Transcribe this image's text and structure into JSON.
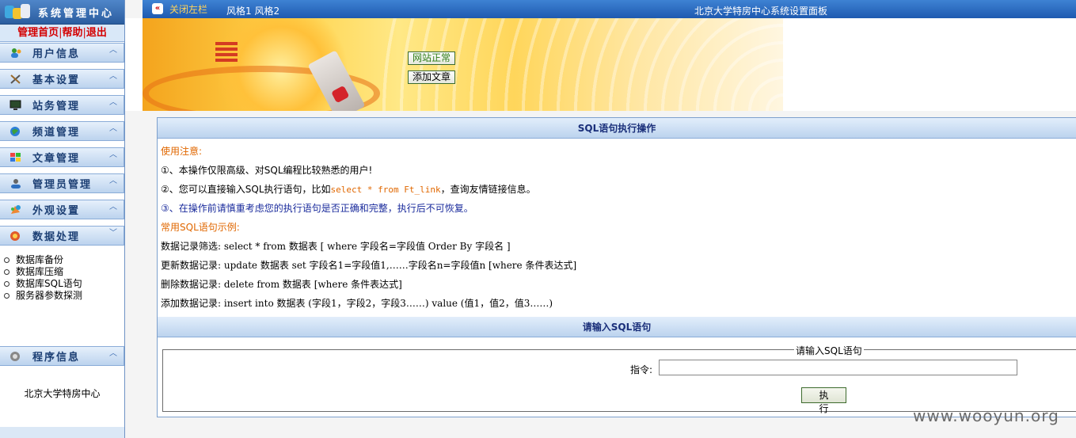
{
  "sidebar": {
    "title": "系统管理中心",
    "links": [
      "管理首页",
      "帮助",
      "退出"
    ],
    "sections": [
      {
        "label": "用户信息",
        "icon": "users-icon",
        "chevron": "︿"
      },
      {
        "label": "基本设置",
        "icon": "tools-icon",
        "chevron": "︿"
      },
      {
        "label": "站务管理",
        "icon": "monitor-icon",
        "chevron": "︿"
      },
      {
        "label": "频道管理",
        "icon": "globe-icon",
        "chevron": "︿"
      },
      {
        "label": "文章管理",
        "icon": "windows-icon",
        "chevron": "︿"
      },
      {
        "label": "管理员管理",
        "icon": "admin-user-icon",
        "chevron": "︿"
      },
      {
        "label": "外观设置",
        "icon": "paint-icon",
        "chevron": "︿"
      },
      {
        "label": "数据处理",
        "icon": "data-icon",
        "chevron": "﹀"
      }
    ],
    "data_items": [
      "数据库备份",
      "数据库压缩",
      "数据库SQL语句",
      "服务器参数探测"
    ],
    "program_info": {
      "label": "程序信息",
      "icon": "program-icon",
      "chevron": "︿"
    },
    "footer_text": "北京大学特房中心"
  },
  "topbar": {
    "collapse_symbol": "«",
    "close_left": "关闭左栏",
    "style_links": [
      "风格1",
      "风格2"
    ],
    "panel_title": "北京大学特房中心系统设置面板"
  },
  "banner": {
    "status_button": "网站正常",
    "add_button": "添加文章"
  },
  "sql_panel": {
    "title": "SQL语句执行操作",
    "notice_label": "使用注意:",
    "note1": "①、本操作仅限高级、对SQL编程比较熟悉的用户!",
    "note2_prefix": "②、您可以直接输入SQL执行语句，比如",
    "note2_code": "select * from Ft_link",
    "note2_suffix": "，查询友情链接信息。",
    "note3": "③、在操作前请慎重考虑您的执行语句是否正确和完整，执行后不可恢复。",
    "examples_label": "常用SQL语句示例:",
    "examples": [
      "数据记录筛选: select * from 数据表 [ where 字段名=字段值 Order By 字段名 ]",
      "更新数据记录: update 数据表 set 字段名1=字段值1,……字段名n=字段值n [where 条件表达式]",
      "删除数据记录: delete from 数据表 [where 条件表达式]",
      "添加数据记录: insert into 数据表 (字段1，字段2，字段3……) value (值1，值2，值3……)"
    ]
  },
  "input_panel": {
    "title": "请输入SQL语句",
    "legend": "请输入SQL语句",
    "command_label": "指令:",
    "command_value": "",
    "execute_button": "执 行"
  },
  "watermark": "www.wooyun.org"
}
